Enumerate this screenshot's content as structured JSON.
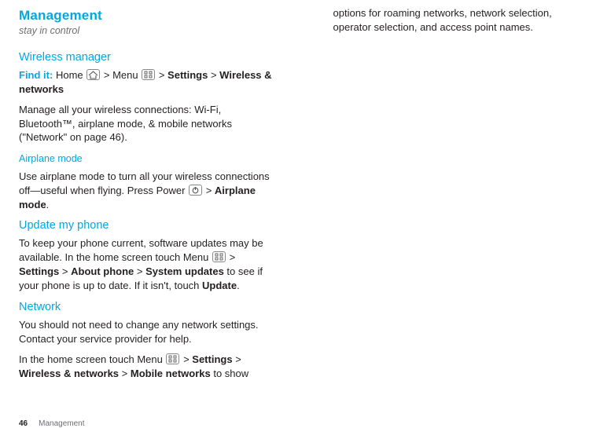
{
  "header": {
    "title": "Management",
    "tagline": "stay in control"
  },
  "wireless_manager": {
    "heading": "Wireless manager",
    "findit_label": "Find it:",
    "path": {
      "home": "Home",
      "gt1": " > Menu ",
      "gt2": " > ",
      "settings": "Settings",
      "gt3": " > ",
      "wn": "Wireless & networks"
    },
    "body": "Manage all your wireless connections: Wi-Fi, Bluetooth™, airplane mode, & mobile networks (\"Network\" on page 46)."
  },
  "airplane": {
    "heading": "Airplane mode",
    "body_pre": "Use airplane mode to turn all your wireless connections off—useful when flying. Press Power ",
    "body_post": " > ",
    "mode": "Airplane mode",
    "body_end": "."
  },
  "update": {
    "heading": "Update my phone",
    "p1_pre": "To keep your phone current, software updates may be available. In the home screen touch Menu ",
    "p1_gt": " > ",
    "settings": "Settings",
    "gt2": " > ",
    "about": "About phone",
    "gt3": " > ",
    "sys": "System updates",
    "p1_post": " to see if your phone is up to date. If it isn't, touch ",
    "update_btn": "Update",
    "p1_end": "."
  },
  "network": {
    "heading": "Network",
    "p1": "You should not need to change any network settings. Contact your service provider for help.",
    "p2_pre": "In the home screen touch Menu ",
    "gt1": " > ",
    "settings": "Settings",
    "gt2": " > ",
    "wn": "Wireless & networks",
    "gt3": " > ",
    "mobile": "Mobile networks",
    "p2_post": " to show "
  },
  "col2": {
    "p": "options for roaming networks, network selection, operator selection, and access point names."
  },
  "footer": {
    "page": "46",
    "section": "Management"
  }
}
